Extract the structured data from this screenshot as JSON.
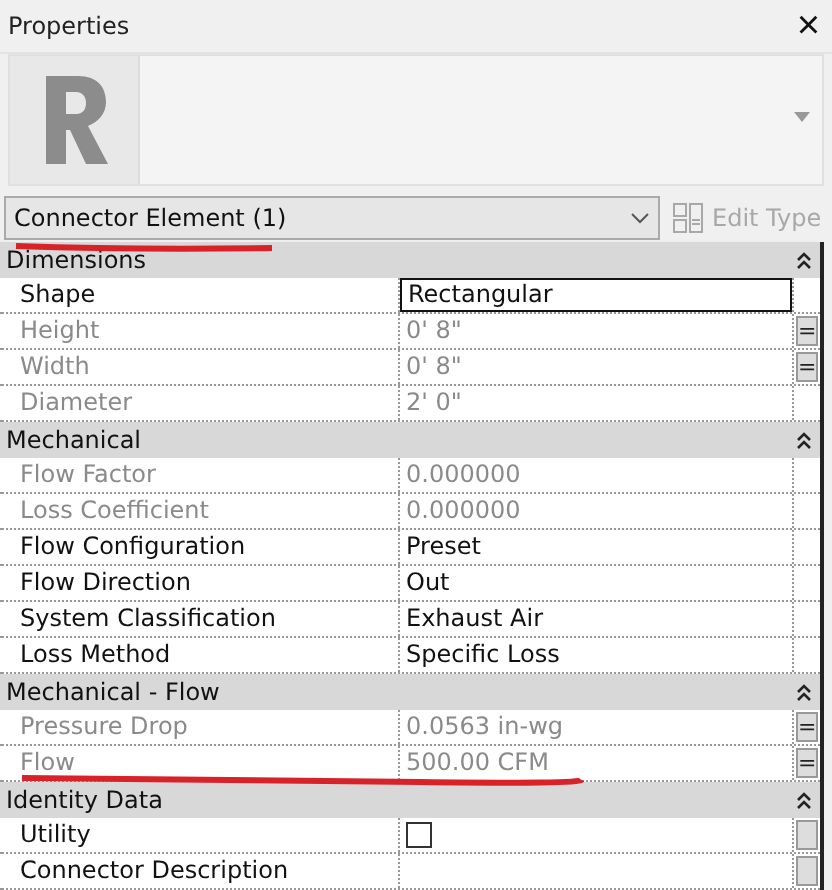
{
  "panel": {
    "title": "Properties",
    "close": "×"
  },
  "type_selector": {
    "value": "Connector Element (1)",
    "underlined": true
  },
  "edit_type": {
    "label": "Edit Type",
    "disabled": true
  },
  "sections": [
    {
      "title": "Dimensions",
      "expanded": true,
      "rows": [
        {
          "label": "Shape",
          "value": "Rectangular",
          "kind": "text",
          "readonly": false,
          "editing": true
        },
        {
          "label": "Height",
          "value": "0'  8\"",
          "kind": "text",
          "readonly": true,
          "param_label": "="
        },
        {
          "label": "Width",
          "value": "0'  8\"",
          "kind": "text",
          "readonly": true,
          "param_label": "="
        },
        {
          "label": "Diameter",
          "value": "2'  0\"",
          "kind": "text",
          "readonly": true
        }
      ]
    },
    {
      "title": "Mechanical",
      "expanded": true,
      "rows": [
        {
          "label": "Flow Factor",
          "value": "0.000000",
          "kind": "text",
          "readonly": true
        },
        {
          "label": "Loss Coefficient",
          "value": "0.000000",
          "kind": "text",
          "readonly": true
        },
        {
          "label": "Flow Configuration",
          "value": "Preset",
          "kind": "text",
          "readonly": false
        },
        {
          "label": "Flow Direction",
          "value": "Out",
          "kind": "text",
          "readonly": false
        },
        {
          "label": "System Classification",
          "value": "Exhaust Air",
          "kind": "text",
          "readonly": false
        },
        {
          "label": "Loss Method",
          "value": "Specific Loss",
          "kind": "text",
          "readonly": false
        }
      ]
    },
    {
      "title": "Mechanical - Flow",
      "expanded": true,
      "rows": [
        {
          "label": "Pressure Drop",
          "value": "0.0563 in-wg",
          "kind": "text",
          "readonly": true,
          "param_label": "="
        },
        {
          "label": "Flow",
          "value": "500.00 CFM",
          "kind": "text",
          "readonly": true,
          "param_label": "=",
          "underlined": true
        }
      ]
    },
    {
      "title": "Identity Data",
      "expanded": true,
      "rows": [
        {
          "label": "Utility",
          "kind": "checkbox",
          "checked": false,
          "readonly": false,
          "param_button": true
        },
        {
          "label": "Connector Description",
          "kind": "text",
          "readonly": false,
          "param_button": true
        }
      ]
    }
  ]
}
